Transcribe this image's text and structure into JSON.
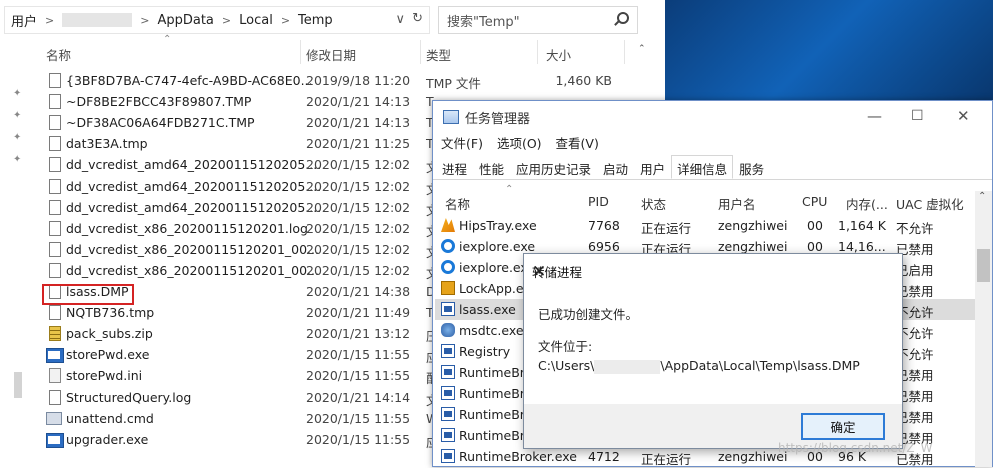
{
  "explorer": {
    "breadcrumb": [
      "用户",
      "AppData",
      "Local",
      "Temp"
    ],
    "search_placeholder": "搜索\"Temp\"",
    "columns": {
      "name": "名称",
      "date": "修改日期",
      "type": "类型",
      "size": "大小"
    },
    "files": [
      {
        "name": "{3BF8D7BA-C747-4efc-A9BD-AC68E0...",
        "date": "2019/9/18 11:20",
        "type": "TMP 文件",
        "size": "1,460 KB",
        "icon": "file-icon"
      },
      {
        "name": "~DF8BE2FBCC43F89807.TMP",
        "date": "2020/1/21 14:13",
        "type": "T",
        "size": "",
        "icon": "file-icon"
      },
      {
        "name": "~DF38AC06A64FDB271C.TMP",
        "date": "2020/1/21 14:13",
        "type": "T",
        "size": "",
        "icon": "file-icon"
      },
      {
        "name": "dat3E3A.tmp",
        "date": "2020/1/21 11:25",
        "type": "T",
        "size": "",
        "icon": "file-icon"
      },
      {
        "name": "dd_vcredist_amd64_20200115120205....",
        "date": "2020/1/15 12:02",
        "type": "文",
        "size": "",
        "icon": "file-icon"
      },
      {
        "name": "dd_vcredist_amd64_20200115120205....",
        "date": "2020/1/15 12:02",
        "type": "文",
        "size": "",
        "icon": "file-icon"
      },
      {
        "name": "dd_vcredist_amd64_20200115120205....",
        "date": "2020/1/15 12:02",
        "type": "文",
        "size": "",
        "icon": "file-icon"
      },
      {
        "name": "dd_vcredist_x86_20200115120201.log",
        "date": "2020/1/15 12:02",
        "type": "文",
        "size": "",
        "icon": "file-icon"
      },
      {
        "name": "dd_vcredist_x86_20200115120201_00...",
        "date": "2020/1/15 12:02",
        "type": "文",
        "size": "",
        "icon": "file-icon"
      },
      {
        "name": "dd_vcredist_x86_20200115120201_00...",
        "date": "2020/1/15 12:02",
        "type": "文",
        "size": "",
        "icon": "file-icon"
      },
      {
        "name": "lsass.DMP",
        "date": "2020/1/21 14:38",
        "type": "D",
        "size": "",
        "icon": "file-icon"
      },
      {
        "name": "NQTB736.tmp",
        "date": "2020/1/21 11:49",
        "type": "T",
        "size": "",
        "icon": "file-icon"
      },
      {
        "name": "pack_subs.zip",
        "date": "2020/1/21 13:12",
        "type": "压",
        "size": "",
        "icon": "zip-icon"
      },
      {
        "name": "storePwd.exe",
        "date": "2020/1/15 11:55",
        "type": "应",
        "size": "",
        "icon": "exe-icon"
      },
      {
        "name": "storePwd.ini",
        "date": "2020/1/15 11:55",
        "type": "配",
        "size": "",
        "icon": "ini-icon"
      },
      {
        "name": "StructuredQuery.log",
        "date": "2020/1/21 14:14",
        "type": "文",
        "size": "",
        "icon": "file-icon"
      },
      {
        "name": "unattend.cmd",
        "date": "2020/1/15 11:55",
        "type": "W",
        "size": "",
        "icon": "cmd-icon"
      },
      {
        "name": "upgrader.exe",
        "date": "2020/1/15 11:55",
        "type": "应",
        "size": "",
        "icon": "exe-icon"
      }
    ]
  },
  "taskmgr": {
    "title": "任务管理器",
    "menu": [
      "文件(F)",
      "选项(O)",
      "查看(V)"
    ],
    "tabs": [
      "进程",
      "性能",
      "应用历史记录",
      "启动",
      "用户",
      "详细信息",
      "服务"
    ],
    "active_tab": "详细信息",
    "columns": {
      "name": "名称",
      "pid": "PID",
      "status": "状态",
      "user": "用户名",
      "cpu": "CPU",
      "mem": "内存(...",
      "uac": "UAC 虚拟化"
    },
    "processes": [
      {
        "name": "HipsTray.exe",
        "pid": "7768",
        "status": "正在运行",
        "user": "zengzhiwei",
        "cpu": "00",
        "mem": "1,164 K",
        "uac": "不允许",
        "icon": "hips-icon"
      },
      {
        "name": "iexplore.exe",
        "pid": "6956",
        "status": "正在运行",
        "user": "zengzhiwei",
        "cpu": "00",
        "mem": "14,16...",
        "uac": "已禁用",
        "icon": "ie-icon"
      },
      {
        "name": "iexplore.exe",
        "pid": "",
        "status": "",
        "user": "",
        "cpu": "",
        "mem": "",
        "uac": "已启用",
        "icon": "ie-icon"
      },
      {
        "name": "LockApp.exe",
        "pid": "",
        "status": "",
        "user": "",
        "cpu": "",
        "mem": "",
        "uac": "已禁用",
        "icon": "lock-icon"
      },
      {
        "name": "lsass.exe",
        "pid": "",
        "status": "",
        "user": "",
        "cpu": "",
        "mem": "",
        "uac": "不允许",
        "icon": "process-icon"
      },
      {
        "name": "msdtc.exe",
        "pid": "",
        "status": "",
        "user": "",
        "cpu": "",
        "mem": "",
        "uac": "不允许",
        "icon": "msdtc-icon"
      },
      {
        "name": "Registry",
        "pid": "",
        "status": "",
        "user": "",
        "cpu": "",
        "mem": "",
        "uac": "不允许",
        "icon": "process-icon"
      },
      {
        "name": "RuntimeBro",
        "pid": "",
        "status": "",
        "user": "",
        "cpu": "",
        "mem": "",
        "uac": "已禁用",
        "icon": "process-icon"
      },
      {
        "name": "RuntimeBro",
        "pid": "",
        "status": "",
        "user": "",
        "cpu": "",
        "mem": "",
        "uac": "已禁用",
        "icon": "process-icon"
      },
      {
        "name": "RuntimeBro",
        "pid": "",
        "status": "",
        "user": "",
        "cpu": "",
        "mem": "",
        "uac": "已禁用",
        "icon": "process-icon"
      },
      {
        "name": "RuntimeBro",
        "pid": "",
        "status": "",
        "user": "",
        "cpu": "",
        "mem": "",
        "uac": "已禁用",
        "icon": "process-icon"
      },
      {
        "name": "RuntimeBroker.exe",
        "pid": "4712",
        "status": "正在运行",
        "user": "zengzhiwei",
        "cpu": "00",
        "mem": "96 K",
        "uac": "已禁用",
        "icon": "process-icon"
      }
    ]
  },
  "dialog": {
    "title": "转储进程",
    "message": "已成功创建文件。",
    "location_label": "文件位于:",
    "path_prefix": "C:\\Users\\",
    "path_suffix": "\\AppData\\Local\\Temp\\lsass.DMP",
    "ok_label": "确定"
  },
  "watermark": "https://blog.csdn.net/Z_W"
}
